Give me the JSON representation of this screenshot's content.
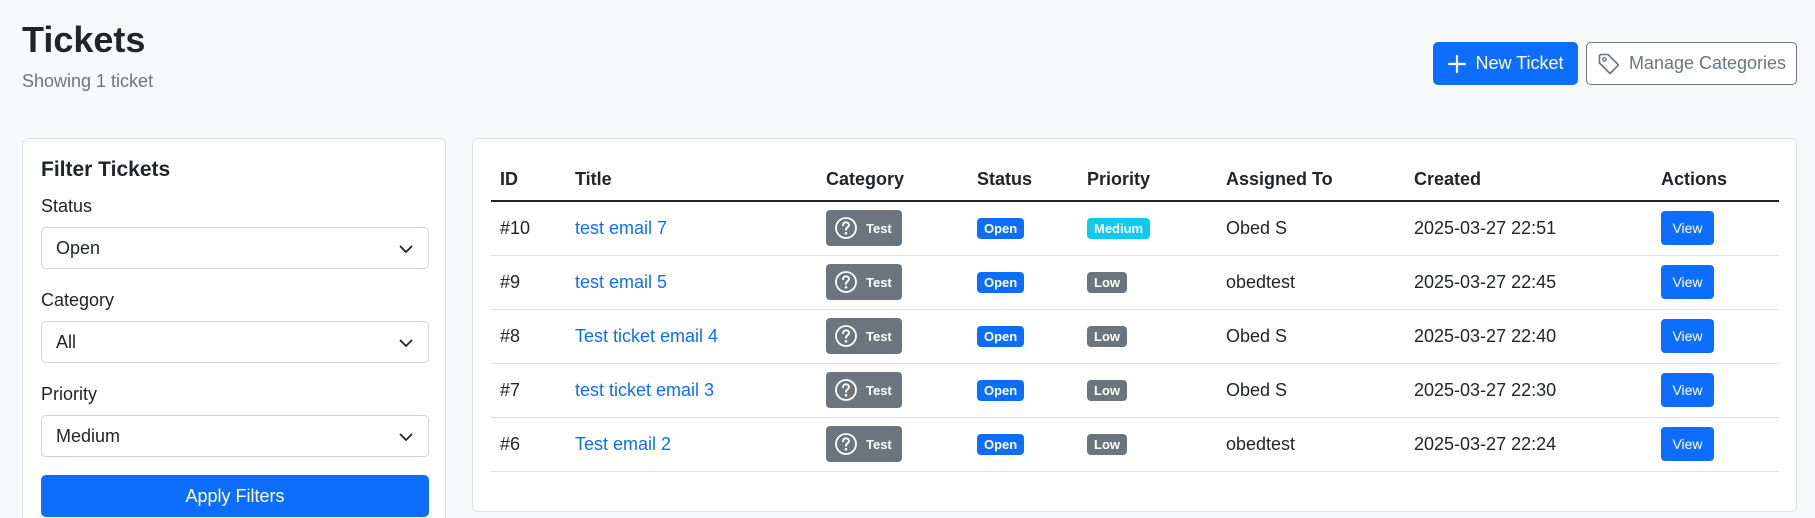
{
  "header": {
    "title": "Tickets",
    "subtitle": "Showing 1 ticket",
    "new_ticket_label": "New Ticket",
    "manage_categories_label": "Manage Categories"
  },
  "filters": {
    "title": "Filter Tickets",
    "status_label": "Status",
    "status_value": "Open",
    "category_label": "Category",
    "category_value": "All",
    "priority_label": "Priority",
    "priority_value": "Medium",
    "apply_label": "Apply Filters"
  },
  "table": {
    "columns": [
      "ID",
      "Title",
      "Category",
      "Status",
      "Priority",
      "Assigned To",
      "Created",
      "Actions"
    ],
    "rows": [
      {
        "id": "#10",
        "title": "test email 7",
        "category": "Test",
        "status": "Open",
        "priority": "Medium",
        "assigned": "Obed S",
        "created": "2025-03-27 22:51",
        "action": "View"
      },
      {
        "id": "#9",
        "title": "test email 5",
        "category": "Test",
        "status": "Open",
        "priority": "Low",
        "assigned": "obedtest",
        "created": "2025-03-27 22:45",
        "action": "View"
      },
      {
        "id": "#8",
        "title": "Test ticket email 4",
        "category": "Test",
        "status": "Open",
        "priority": "Low",
        "assigned": "Obed S",
        "created": "2025-03-27 22:40",
        "action": "View"
      },
      {
        "id": "#7",
        "title": "test ticket email 3",
        "category": "Test",
        "status": "Open",
        "priority": "Low",
        "assigned": "Obed S",
        "created": "2025-03-27 22:30",
        "action": "View"
      },
      {
        "id": "#6",
        "title": "Test email 2",
        "category": "Test",
        "status": "Open",
        "priority": "Low",
        "assigned": "obedtest",
        "created": "2025-03-27 22:24",
        "action": "View"
      }
    ]
  },
  "icons": {
    "new_ticket": "plus-icon",
    "manage_categories": "tag-icon",
    "category": "question-circle-icon",
    "select": "chevron-down-icon"
  },
  "colors": {
    "primary": "#0d6efd",
    "secondary": "#6c757d",
    "info": "#0dcaf0",
    "background": "#f8f9fa"
  }
}
